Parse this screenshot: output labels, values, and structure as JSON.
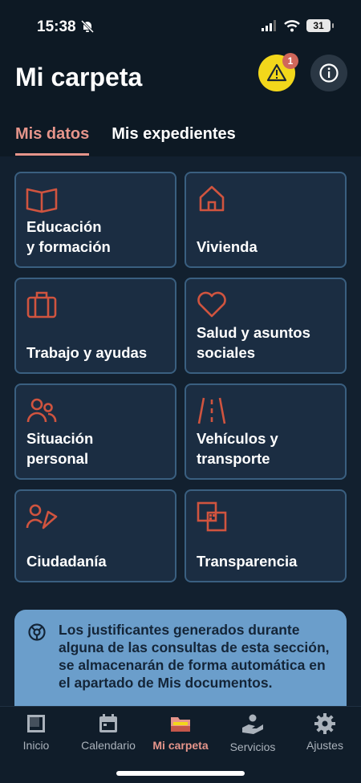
{
  "status_bar": {
    "time": "15:38",
    "battery": "31"
  },
  "header": {
    "title": "Mi carpeta",
    "alert_badge": "1",
    "tabs": [
      {
        "label": "Mis datos",
        "active": true
      },
      {
        "label": "Mis expedientes",
        "active": false
      }
    ]
  },
  "categories": [
    {
      "label": "Educación\ny formación",
      "icon": "book-icon"
    },
    {
      "label": "Vivienda",
      "icon": "house-icon"
    },
    {
      "label": "Trabajo y ayudas",
      "icon": "briefcase-icon"
    },
    {
      "label": "Salud y asuntos\nsociales",
      "icon": "heart-icon"
    },
    {
      "label": "Situación\npersonal",
      "icon": "people-icon"
    },
    {
      "label": "Vehículos y\ntransporte",
      "icon": "road-icon"
    },
    {
      "label": "Ciudadanía",
      "icon": "citizen-flag-icon"
    },
    {
      "label": "Transparencia",
      "icon": "squares-icon"
    }
  ],
  "notice": {
    "text": "Los justificantes generados durante alguna de las consultas de esta sección, se almacenarán de forma automática en el apartado de Mis documentos."
  },
  "bottom_nav": [
    {
      "label": "Inicio",
      "active": false
    },
    {
      "label": "Calendario",
      "active": false
    },
    {
      "label": "Mi carpeta",
      "active": true
    },
    {
      "label": "Servicios",
      "active": false
    },
    {
      "label": "Ajustes",
      "active": false
    }
  ],
  "colors": {
    "accent": "#e6958b",
    "icon": "#d0543f",
    "alert": "#f2d71b",
    "card_border": "#3a5f80",
    "notice_bg": "#6b9ecb"
  }
}
